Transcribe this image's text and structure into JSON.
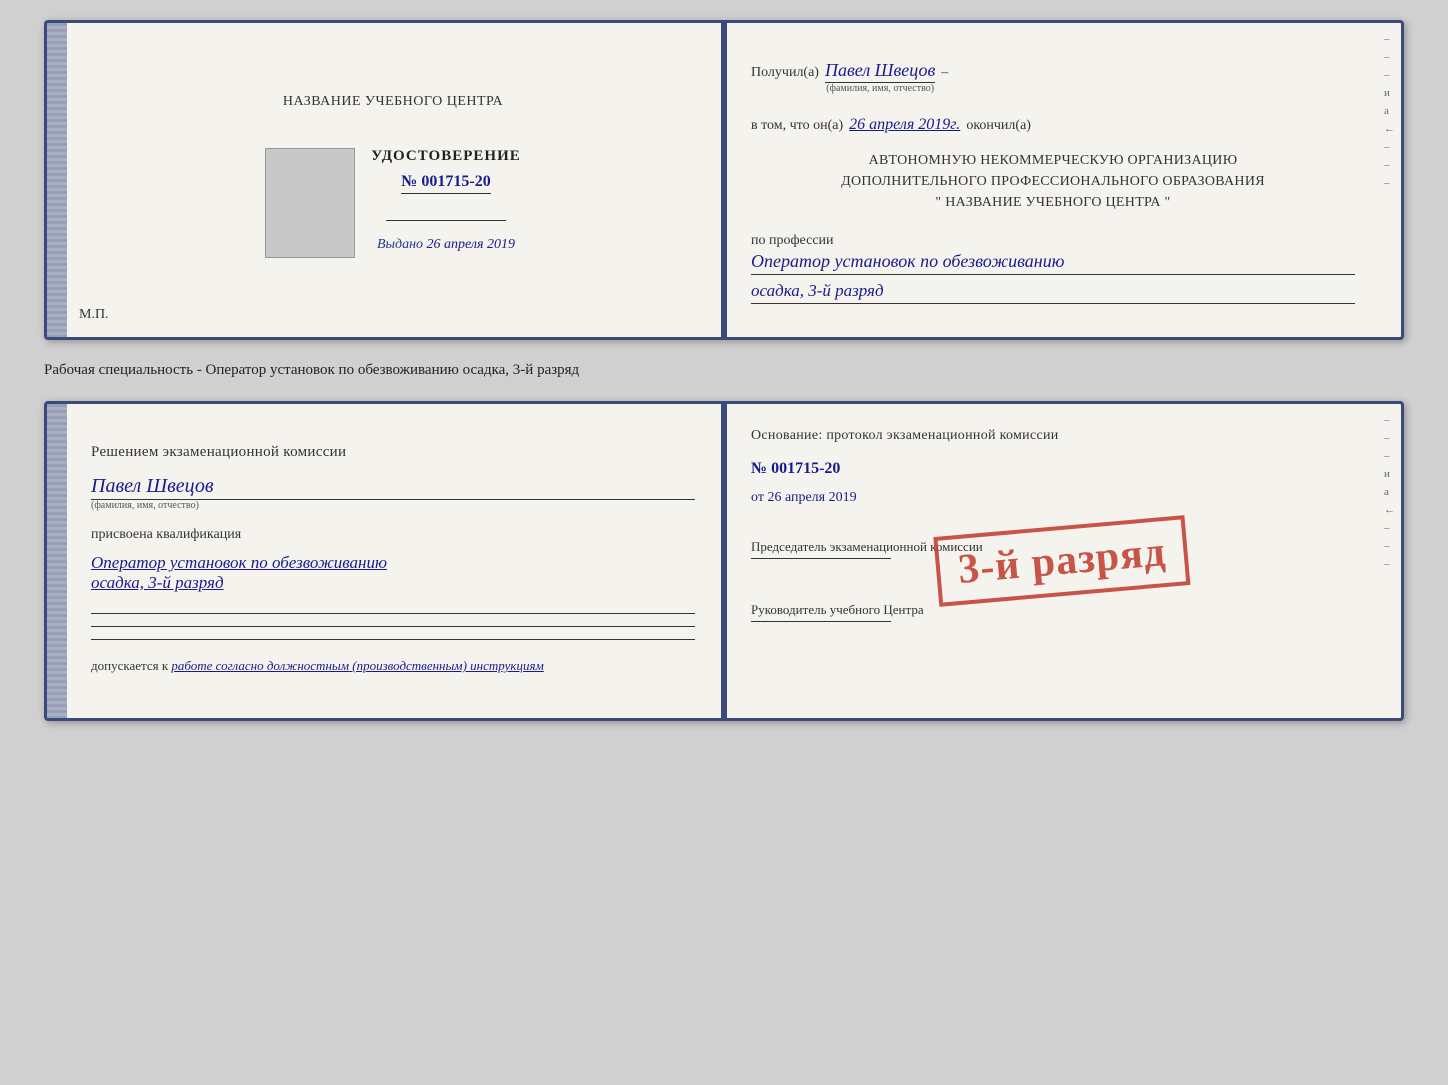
{
  "top_card": {
    "left": {
      "training_center": "НАЗВАНИЕ УЧЕБНОГО ЦЕНТРА",
      "cert_label": "УДОСТОВЕРЕНИЕ",
      "cert_number": "№ 001715-20",
      "issued_label": "Выдано",
      "issued_date": "26 апреля 2019",
      "mp_label": "М.П."
    },
    "right": {
      "received_prefix": "Получил(а)",
      "received_name": "Павел Швецов",
      "fio_subtitle": "(фамилия, имя, отчество)",
      "dash": "–",
      "in_that_prefix": "в том, что он(а)",
      "in_that_date": "26 апреля 2019г.",
      "finished_label": "окончил(а)",
      "org_line1": "АВТОНОМНУЮ НЕКОММЕРЧЕСКУЮ ОРГАНИЗАЦИЮ",
      "org_line2": "ДОПОЛНИТЕЛЬНОГО ПРОФЕССИОНАЛЬНОГО ОБРАЗОВАНИЯ",
      "org_line3": "\"   НАЗВАНИЕ УЧЕБНОГО ЦЕНТРА   \"",
      "profession_label": "по профессии",
      "profession_value": "Оператор установок по обезвоживанию",
      "profession_rank": "осадка, 3-й разряд",
      "right_marks": [
        "–",
        "–",
        "и",
        "а",
        "←",
        "–",
        "–",
        "–",
        "–"
      ]
    }
  },
  "between": {
    "text": "Рабочая специальность - Оператор установок по обезвоживанию осадка, 3-й разряд"
  },
  "bottom_card": {
    "left": {
      "decision_title": "Решением экзаменационной комиссии",
      "person_name": "Павел Швецов",
      "fio_subtitle": "(фамилия, имя, отчество)",
      "qualification_label": "присвоена квалификация",
      "qualification_value": "Оператор установок по обезвоживанию",
      "qualification_rank": "осадка, 3-й разряд",
      "admitted_prefix": "допускается к",
      "admitted_value": "работе согласно должностным (производственным) инструкциям"
    },
    "right": {
      "basis_title": "Основание: протокол экзаменационной комиссии",
      "basis_number": "№ 001715-20",
      "basis_date_prefix": "от",
      "basis_date": "26 апреля 2019",
      "chairman_label": "Председатель экзаменационной комиссии",
      "director_label": "Руководитель учебного Центра",
      "right_marks": [
        "–",
        "–",
        "–",
        "–",
        "и",
        "а",
        "←",
        "–",
        "–",
        "–"
      ]
    },
    "stamp": {
      "text": "3-й разряд"
    }
  }
}
